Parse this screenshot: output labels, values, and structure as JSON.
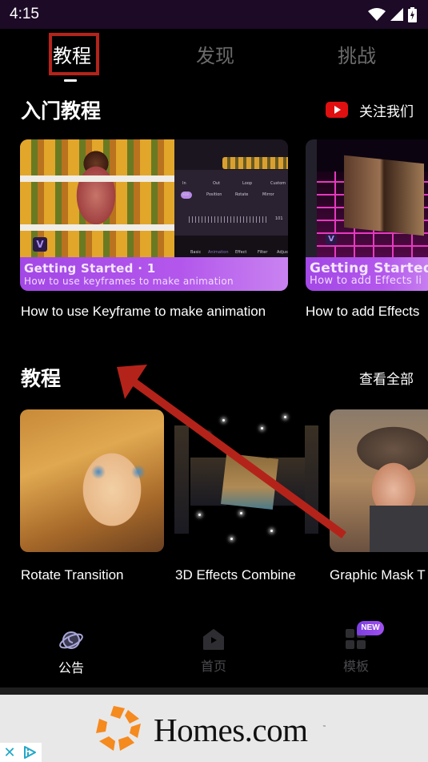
{
  "status_bar": {
    "time": "4:15",
    "icons": [
      "wifi-icon",
      "cell-signal-icon",
      "battery-charging-icon"
    ]
  },
  "top_tabs": {
    "items": [
      {
        "label": "教程",
        "active": true
      },
      {
        "label": "发现",
        "active": false
      },
      {
        "label": "挑战",
        "active": false
      }
    ]
  },
  "getting_started": {
    "title": "入门教程",
    "follow_label": "关注我们",
    "follow_icon": "youtube-icon",
    "cards": [
      {
        "banner_title": "Getting Started · 1",
        "banner_subtitle": "How to use keyframes to make animation",
        "caption": "How to use Keyframe to make animation",
        "app_ui_labels": {
          "tabs": [
            "In",
            "Out",
            "Loop",
            "Custom"
          ],
          "chips": [
            "Size",
            "Position",
            "Rotate",
            "Mirror"
          ],
          "slider_value": "101",
          "toolbar": [
            "Basic",
            "Animation",
            "Effect",
            "Filter",
            "Adjust"
          ]
        }
      },
      {
        "banner_title": "Getting Started",
        "banner_subtitle": "How to add Effects li",
        "caption": "How to add Effects"
      }
    ]
  },
  "tutorials": {
    "title": "教程",
    "view_all_label": "查看全部",
    "items": [
      {
        "caption": "Rotate Transition"
      },
      {
        "caption": "3D Effects Combine"
      },
      {
        "caption": "Graphic Mask T"
      }
    ]
  },
  "bottom_nav": {
    "items": [
      {
        "label": "公告",
        "icon": "planet-icon",
        "active": true
      },
      {
        "label": "首页",
        "icon": "home-play-icon",
        "active": false
      },
      {
        "label": "模板",
        "icon": "grid-icon",
        "active": false,
        "badge": "NEW"
      }
    ]
  },
  "ad": {
    "brand": "Homes.com",
    "tm": "™",
    "brand_color": "#f58a1f",
    "close_glyph": "✕"
  },
  "colors": {
    "accent_purple": "#a347e6",
    "annotation_red": "#b4231a",
    "youtube_red": "#e01010"
  }
}
